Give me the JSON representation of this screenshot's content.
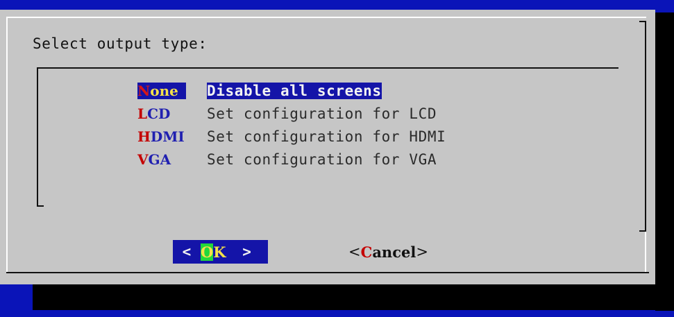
{
  "dialog": {
    "prompt": "Select output type:"
  },
  "menu": {
    "items": [
      {
        "tag_hot": "N",
        "tag_rest": "one",
        "description": "Disable all screens",
        "selected": true
      },
      {
        "tag_hot": "L",
        "tag_rest": "CD",
        "description": "Set configuration for LCD",
        "selected": false
      },
      {
        "tag_hot": "H",
        "tag_rest": "DMI",
        "description": "Set configuration for HDMI",
        "selected": false
      },
      {
        "tag_hot": "V",
        "tag_rest": "GA",
        "description": "Set configuration for VGA",
        "selected": false
      }
    ]
  },
  "buttons": {
    "ok": {
      "open": "<",
      "hot": "O",
      "rest": "K",
      "close": ">"
    },
    "cancel": {
      "open": "<",
      "hot": "C",
      "rest": "ancel",
      "close": ">"
    }
  },
  "colors": {
    "screen_bg": "#0a14b8",
    "dialog_bg": "#c6c6c6",
    "highlight_bg": "#1414a8",
    "hotkey": "#c40000",
    "highlight_text": "#f4e04a",
    "ok_focus": "#22d83a"
  }
}
